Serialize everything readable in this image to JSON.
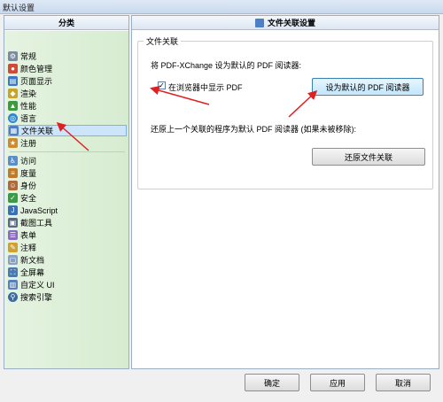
{
  "window": {
    "title": "默认设置"
  },
  "sidebar": {
    "header": "分类",
    "items": [
      {
        "label": "常规",
        "icon": "gear-icon",
        "color": "#7a8aa0"
      },
      {
        "label": "颜色管理",
        "icon": "palette-icon",
        "color": "#d04a3a"
      },
      {
        "label": "页面显示",
        "icon": "page-display-icon",
        "color": "#3b78c4"
      },
      {
        "label": "渲染",
        "icon": "render-icon",
        "color": "#c9a227"
      },
      {
        "label": "性能",
        "icon": "performance-icon",
        "color": "#3f9a3f"
      },
      {
        "label": "语言",
        "icon": "globe-icon",
        "color": "#2f86c9"
      },
      {
        "label": "文件关联",
        "icon": "file-association-icon",
        "color": "#4d7fc7"
      },
      {
        "label": "注册",
        "icon": "register-icon",
        "color": "#d08a2a"
      },
      {
        "label": "访问",
        "icon": "access-icon",
        "color": "#5b8dc9"
      },
      {
        "label": "度量",
        "icon": "ruler-icon",
        "color": "#c07a2a"
      },
      {
        "label": "身份",
        "icon": "identity-icon",
        "color": "#b06a3a"
      },
      {
        "label": "安全",
        "icon": "shield-icon",
        "color": "#3a9a4a"
      },
      {
        "label": "JavaScript",
        "icon": "javascript-icon",
        "color": "#3b6fb8"
      },
      {
        "label": "截图工具",
        "icon": "snapshot-icon",
        "color": "#5a6a80"
      },
      {
        "label": "表单",
        "icon": "form-icon",
        "color": "#8a6ac0"
      },
      {
        "label": "注释",
        "icon": "comment-icon",
        "color": "#d0a030"
      },
      {
        "label": "新文档",
        "icon": "new-document-icon",
        "color": "#8aa0c0"
      },
      {
        "label": "全屏幕",
        "icon": "fullscreen-icon",
        "color": "#4a7ab0"
      },
      {
        "label": "自定义 UI",
        "icon": "customize-ui-icon",
        "color": "#5a80b8"
      },
      {
        "label": "搜索引擎",
        "icon": "search-engine-icon",
        "color": "#3a6aa0"
      }
    ]
  },
  "panel": {
    "header": "文件关联设置",
    "group_title": "文件关联",
    "set_default_text": "将 PDF-XChange 设为默认的 PDF 阅读器:",
    "show_in_browser_label": "在浏览器中显示 PDF",
    "show_in_browser_checked": "✓",
    "set_default_button": "设为默认的 PDF 阅读器",
    "restore_text": "还原上一个关联的程序为默认 PDF 阅读器 (如果未被移除):",
    "restore_button": "还原文件关联"
  },
  "footer": {
    "ok": "确定",
    "apply": "应用",
    "cancel": "取消"
  },
  "annotation_color": "#e02020"
}
